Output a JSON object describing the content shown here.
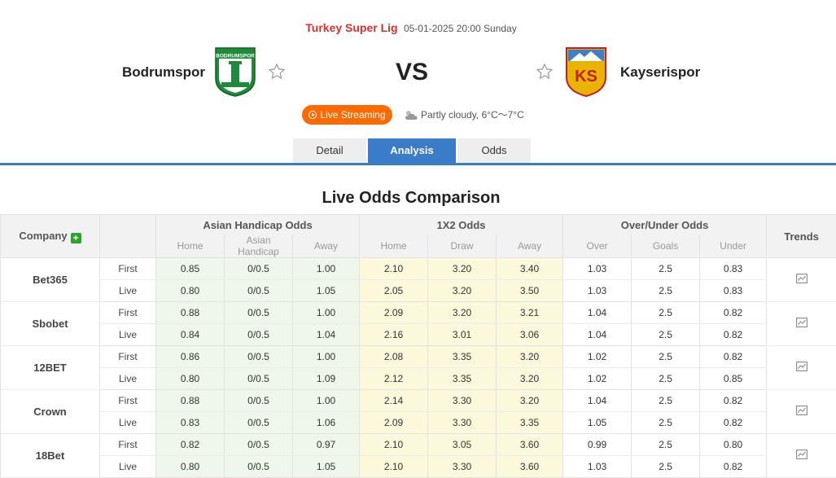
{
  "match": {
    "league": "Turkey Super Lig",
    "datetime": "05-01-2025 20:00 Sunday",
    "home_team": "Bodrumspor",
    "away_team": "Kayserispor",
    "vs": "VS",
    "live_label": "Live Streaming",
    "weather": "Partly cloudy, 6°C～7°C",
    "home_crest_text": "BODRUMSPOR",
    "away_crest_text": "KS"
  },
  "tabs": [
    {
      "label": "Detail",
      "active": false
    },
    {
      "label": "Analysis",
      "active": true
    },
    {
      "label": "Odds",
      "active": false
    }
  ],
  "section_title": "Live Odds Comparison",
  "table": {
    "company_header": "Company",
    "group_headers": {
      "ah": "Asian Handicap Odds",
      "x12": "1X2 Odds",
      "ou": "Over/Under Odds",
      "trends": "Trends"
    },
    "sub_headers": {
      "ah": [
        "Home",
        "Asian Handicap",
        "Away"
      ],
      "x12": [
        "Home",
        "Draw",
        "Away"
      ],
      "ou": [
        "Over",
        "Goals",
        "Under"
      ]
    },
    "rows": [
      {
        "company": "Bet365",
        "first": {
          "label": "First",
          "ah": [
            "0.85",
            "0/0.5",
            "1.00"
          ],
          "x12": [
            "2.10",
            "3.20",
            "3.40"
          ],
          "ou": [
            "1.03",
            "2.5",
            "0.83"
          ]
        },
        "live": {
          "label": "Live",
          "ah": [
            "0.80",
            "0/0.5",
            "1.05"
          ],
          "x12": [
            "2.05",
            "3.20",
            "3.50"
          ],
          "ou": [
            "1.03",
            "2.5",
            "0.83"
          ]
        }
      },
      {
        "company": "Sbobet",
        "first": {
          "label": "First",
          "ah": [
            "0.88",
            "0/0.5",
            "1.00"
          ],
          "x12": [
            "2.09",
            "3.20",
            "3.21"
          ],
          "ou": [
            "1.04",
            "2.5",
            "0.82"
          ]
        },
        "live": {
          "label": "Live",
          "ah": [
            "0.84",
            "0/0.5",
            "1.04"
          ],
          "x12": [
            "2.16",
            "3.01",
            "3.06"
          ],
          "ou": [
            "1.04",
            "2.5",
            "0.82"
          ]
        }
      },
      {
        "company": "12BET",
        "first": {
          "label": "First",
          "ah": [
            "0.86",
            "0/0.5",
            "1.00"
          ],
          "x12": [
            "2.08",
            "3.35",
            "3.20"
          ],
          "ou": [
            "1.02",
            "2.5",
            "0.82"
          ]
        },
        "live": {
          "label": "Live",
          "ah": [
            "0.80",
            "0/0.5",
            "1.09"
          ],
          "x12": [
            "2.12",
            "3.35",
            "3.20"
          ],
          "ou": [
            "1.02",
            "2.5",
            "0.85"
          ]
        }
      },
      {
        "company": "Crown",
        "first": {
          "label": "First",
          "ah": [
            "0.88",
            "0/0.5",
            "1.00"
          ],
          "x12": [
            "2.14",
            "3.30",
            "3.20"
          ],
          "ou": [
            "1.04",
            "2.5",
            "0.82"
          ]
        },
        "live": {
          "label": "Live",
          "ah": [
            "0.83",
            "0/0.5",
            "1.06"
          ],
          "x12": [
            "2.09",
            "3.30",
            "3.35"
          ],
          "ou": [
            "1.05",
            "2.5",
            "0.82"
          ]
        }
      },
      {
        "company": "18Bet",
        "first": {
          "label": "First",
          "ah": [
            "0.82",
            "0/0.5",
            "0.97"
          ],
          "x12": [
            "2.10",
            "3.05",
            "3.60"
          ],
          "ou": [
            "0.99",
            "2.5",
            "0.80"
          ]
        },
        "live": {
          "label": "Live",
          "ah": [
            "0.80",
            "0/0.5",
            "1.05"
          ],
          "x12": [
            "2.10",
            "3.30",
            "3.60"
          ],
          "ou": [
            "1.03",
            "2.5",
            "0.82"
          ]
        }
      }
    ]
  },
  "colors": {
    "league_red": "#d6302f",
    "live_orange": "#ff6a00",
    "tab_blue": "#3a7cc8",
    "plus_green": "#2aa52a",
    "ah_bg": "#eef7ea",
    "x12_bg": "#fbf8dc"
  }
}
